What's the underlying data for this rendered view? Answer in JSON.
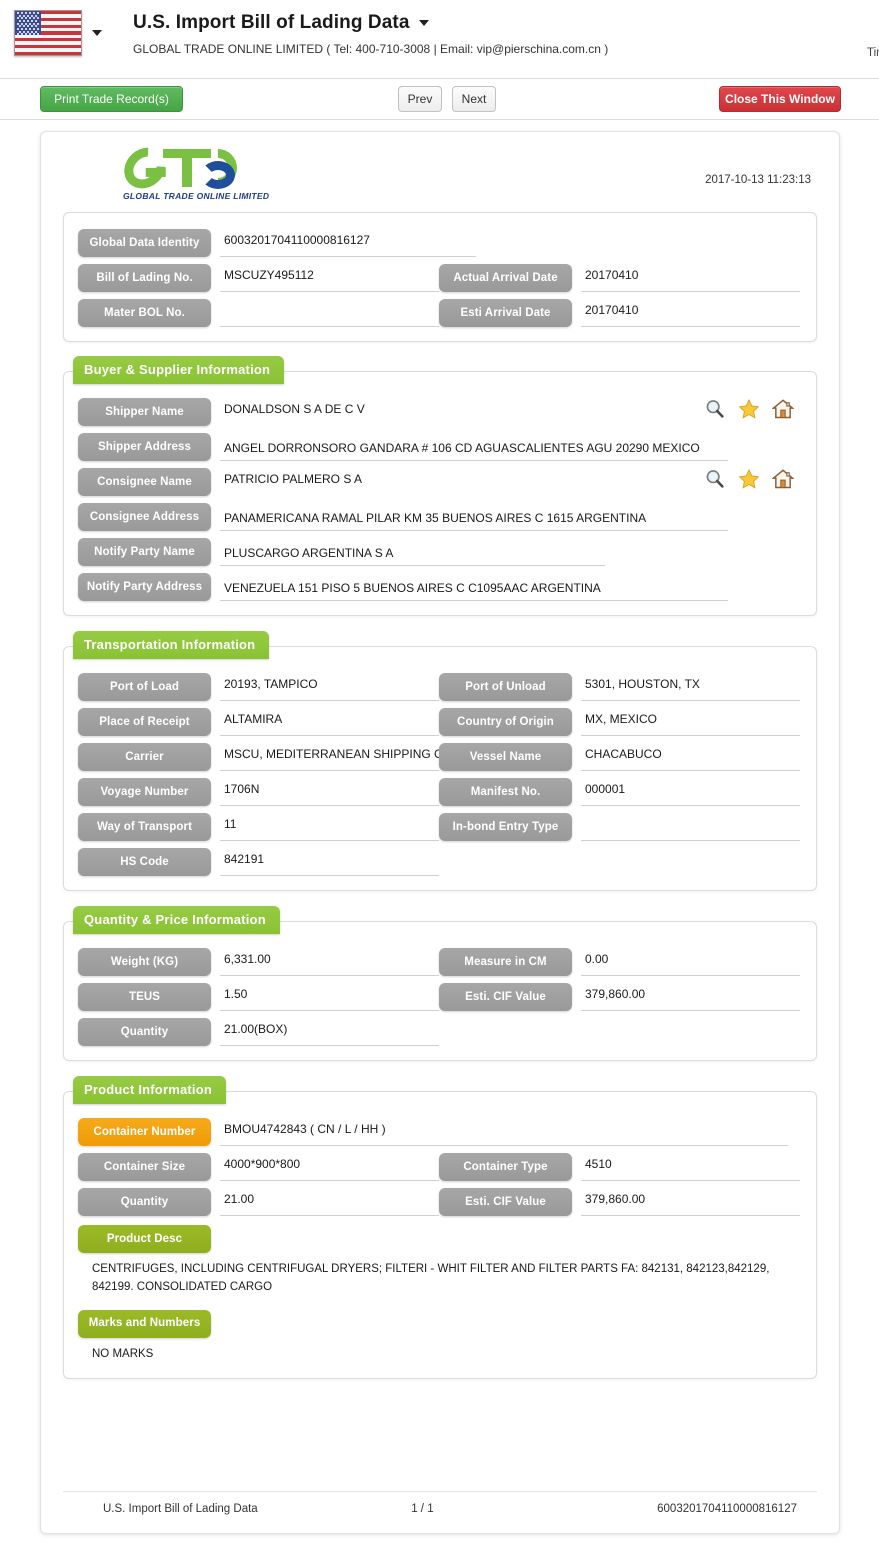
{
  "header": {
    "flag_icon": "us-flag-icon",
    "title": "U.S. Import Bill of Lading Data",
    "subtitle": "GLOBAL TRADE ONLINE LIMITED ( Tel: 400-710-3008 | Email: vip@pierschina.com.cn )",
    "timer_label": "Tim"
  },
  "toolbar": {
    "print_label": "Print Trade Record(s)",
    "prev_label": "Prev",
    "next_label": "Next",
    "close_label": "Close This Window"
  },
  "document": {
    "logo_text": "GLOBAL TRADE  ONLINE LIMITED",
    "timestamp": "2017-10-13 11:23:13"
  },
  "identity": {
    "global_data_identity": {
      "label": "Global Data Identity",
      "value": "6003201704110000816127"
    },
    "bill_of_lading_no": {
      "label": "Bill of Lading No.",
      "value": "MSCUZY495112"
    },
    "actual_arrival_date": {
      "label": "Actual Arrival Date",
      "value": "20170410"
    },
    "mater_bol_no": {
      "label": "Mater BOL No.",
      "value": ""
    },
    "esti_arrival_date": {
      "label": "Esti Arrival Date",
      "value": "20170410"
    }
  },
  "buyer_supplier": {
    "section_title": "Buyer & Supplier Information",
    "shipper_name": {
      "label": "Shipper Name",
      "value": "DONALDSON S A DE C V"
    },
    "shipper_address": {
      "label": "Shipper Address",
      "value": "ANGEL DORRONSORO GANDARA # 106 CD AGUASCALIENTES AGU 20290 MEXICO"
    },
    "consignee_name": {
      "label": "Consignee Name",
      "value": "PATRICIO PALMERO S A"
    },
    "consignee_address": {
      "label": "Consignee Address",
      "value": "PANAMERICANA RAMAL PILAR KM 35 BUENOS AIRES C 1615 ARGENTINA"
    },
    "notify_party_name": {
      "label": "Notify Party Name",
      "value": "PLUSCARGO ARGENTINA S A"
    },
    "notify_party_address": {
      "label": "Notify Party Address",
      "value": "VENEZUELA 151 PISO 5 BUENOS AIRES C C1095AAC ARGENTINA"
    },
    "icons": [
      "search-icon",
      "star-icon",
      "home-icon"
    ]
  },
  "transportation": {
    "section_title": "Transportation Information",
    "port_of_load": {
      "label": "Port of Load",
      "value": "20193, TAMPICO"
    },
    "port_of_unload": {
      "label": "Port of Unload",
      "value": "5301, HOUSTON, TX"
    },
    "place_of_receipt": {
      "label": "Place of Receipt",
      "value": "ALTAMIRA"
    },
    "country_of_origin": {
      "label": "Country of Origin",
      "value": "MX, MEXICO"
    },
    "carrier": {
      "label": "Carrier",
      "value": "MSCU, MEDITERRANEAN SHIPPING C"
    },
    "vessel_name": {
      "label": "Vessel Name",
      "value": "CHACABUCO"
    },
    "voyage_number": {
      "label": "Voyage Number",
      "value": "1706N"
    },
    "manifest_no": {
      "label": "Manifest No.",
      "value": "000001"
    },
    "way_of_transport": {
      "label": "Way of Transport",
      "value": "11"
    },
    "in_bond_entry_type": {
      "label": "In-bond Entry Type",
      "value": ""
    },
    "hs_code": {
      "label": "HS Code",
      "value": "842191"
    }
  },
  "quantity_price": {
    "section_title": "Quantity & Price Information",
    "weight_kg": {
      "label": "Weight (KG)",
      "value": "6,331.00"
    },
    "measure_in_cm": {
      "label": "Measure in CM",
      "value": "0.00"
    },
    "teus": {
      "label": "TEUS",
      "value": "1.50"
    },
    "esti_cif_value": {
      "label": "Esti. CIF Value",
      "value": "379,860.00"
    },
    "quantity": {
      "label": "Quantity",
      "value": "21.00(BOX)"
    }
  },
  "product": {
    "section_title": "Product Information",
    "container_number": {
      "label": "Container Number",
      "value": "BMOU4742843 ( CN / L / HH )"
    },
    "container_size": {
      "label": "Container Size",
      "value": "4000*900*800"
    },
    "container_type": {
      "label": "Container Type",
      "value": "4510"
    },
    "quantity": {
      "label": "Quantity",
      "value": "21.00"
    },
    "esti_cif_value": {
      "label": "Esti. CIF Value",
      "value": "379,860.00"
    },
    "product_desc": {
      "label": "Product Desc",
      "value": "CENTRIFUGES, INCLUDING CENTRIFUGAL DRYERS; FILTERI - WHIT FILTER AND FILTER PARTS FA: 842131, 842123,842129, 842199. CONSOLIDATED CARGO"
    },
    "marks_and_numbers": {
      "label": "Marks and Numbers",
      "value": "NO MARKS"
    }
  },
  "footer": {
    "left": "U.S. Import Bill of Lading Data",
    "center": "1 / 1",
    "right": "6003201704110000816127"
  },
  "colors": {
    "green_header": "#8bc234",
    "olive_label": "#9cba28",
    "orange_label": "#f6aa1c",
    "gray_label": "#9f9f9f",
    "red_button": "#cf3339",
    "green_button": "#4aa94a",
    "logo_green": "#7ac143",
    "logo_blue": "#1f4e9c"
  }
}
